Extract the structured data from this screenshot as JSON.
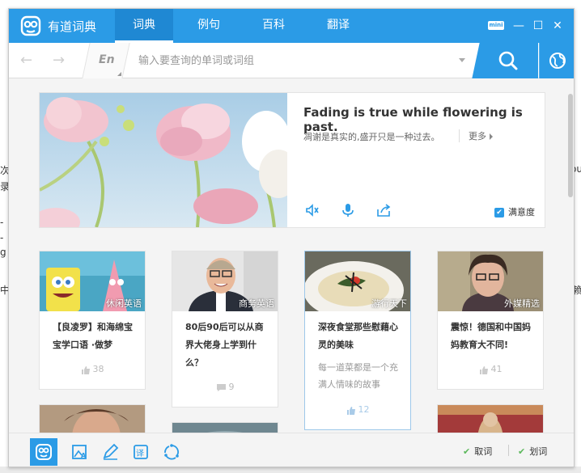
{
  "background": {
    "fragments": [
      "次",
      "录",
      "-",
      "-",
      "g",
      "中",
      "ou",
      "赖"
    ]
  },
  "app": {
    "title": "有道词典",
    "tabs": [
      {
        "label": "词典",
        "active": true
      },
      {
        "label": "例句",
        "active": false
      },
      {
        "label": "百科",
        "active": false
      },
      {
        "label": "翻译",
        "active": false
      }
    ],
    "mini_label": "mini",
    "minimize_glyph": "—",
    "maximize_glyph": "☐",
    "close_glyph": "✕"
  },
  "search": {
    "back_glyph": "←",
    "forward_glyph": "→",
    "language": "En",
    "placeholder": "输入要查询的单词或词组",
    "value": ""
  },
  "featured": {
    "quote_en": "Fading is true while flowering is past.",
    "quote_zh": "凋谢是真实的,盛开只是一种过去。",
    "more": "更多",
    "satisfaction": "满意度",
    "satisfaction_checked": true,
    "icons": [
      "speaker-icon",
      "microphone-icon",
      "share-icon"
    ]
  },
  "cards": [
    {
      "tag": "休闲英语",
      "title": "【良凌罗】和海绵宝宝学口语 ·做梦",
      "desc": "",
      "stat_type": "like",
      "stat": "38"
    },
    {
      "tag": "商务英语",
      "title": "80后90后可以从商界大佬身上学到什么？",
      "desc": "",
      "stat_type": "comment",
      "stat": "9"
    },
    {
      "tag": "游行天下",
      "title": "深夜食堂那些慰藉心灵的美味",
      "desc": "每一道菜都是一个充满人情味的故事",
      "stat_type": "like",
      "stat": "12"
    },
    {
      "tag": "外媒精选",
      "title": "震惊！德国和中国妈妈教育大不同!",
      "desc": "",
      "stat_type": "like",
      "stat": "41"
    }
  ],
  "bottom": {
    "icons": [
      "youdao-logo-icon",
      "image-translate-icon",
      "pen-icon",
      "translate-icon",
      "sync-icon"
    ],
    "option1": "取词",
    "option2": "划词",
    "check_glyph": "✔"
  },
  "colors": {
    "accent": "#2b9be6",
    "check_green": "#5cb85c"
  }
}
